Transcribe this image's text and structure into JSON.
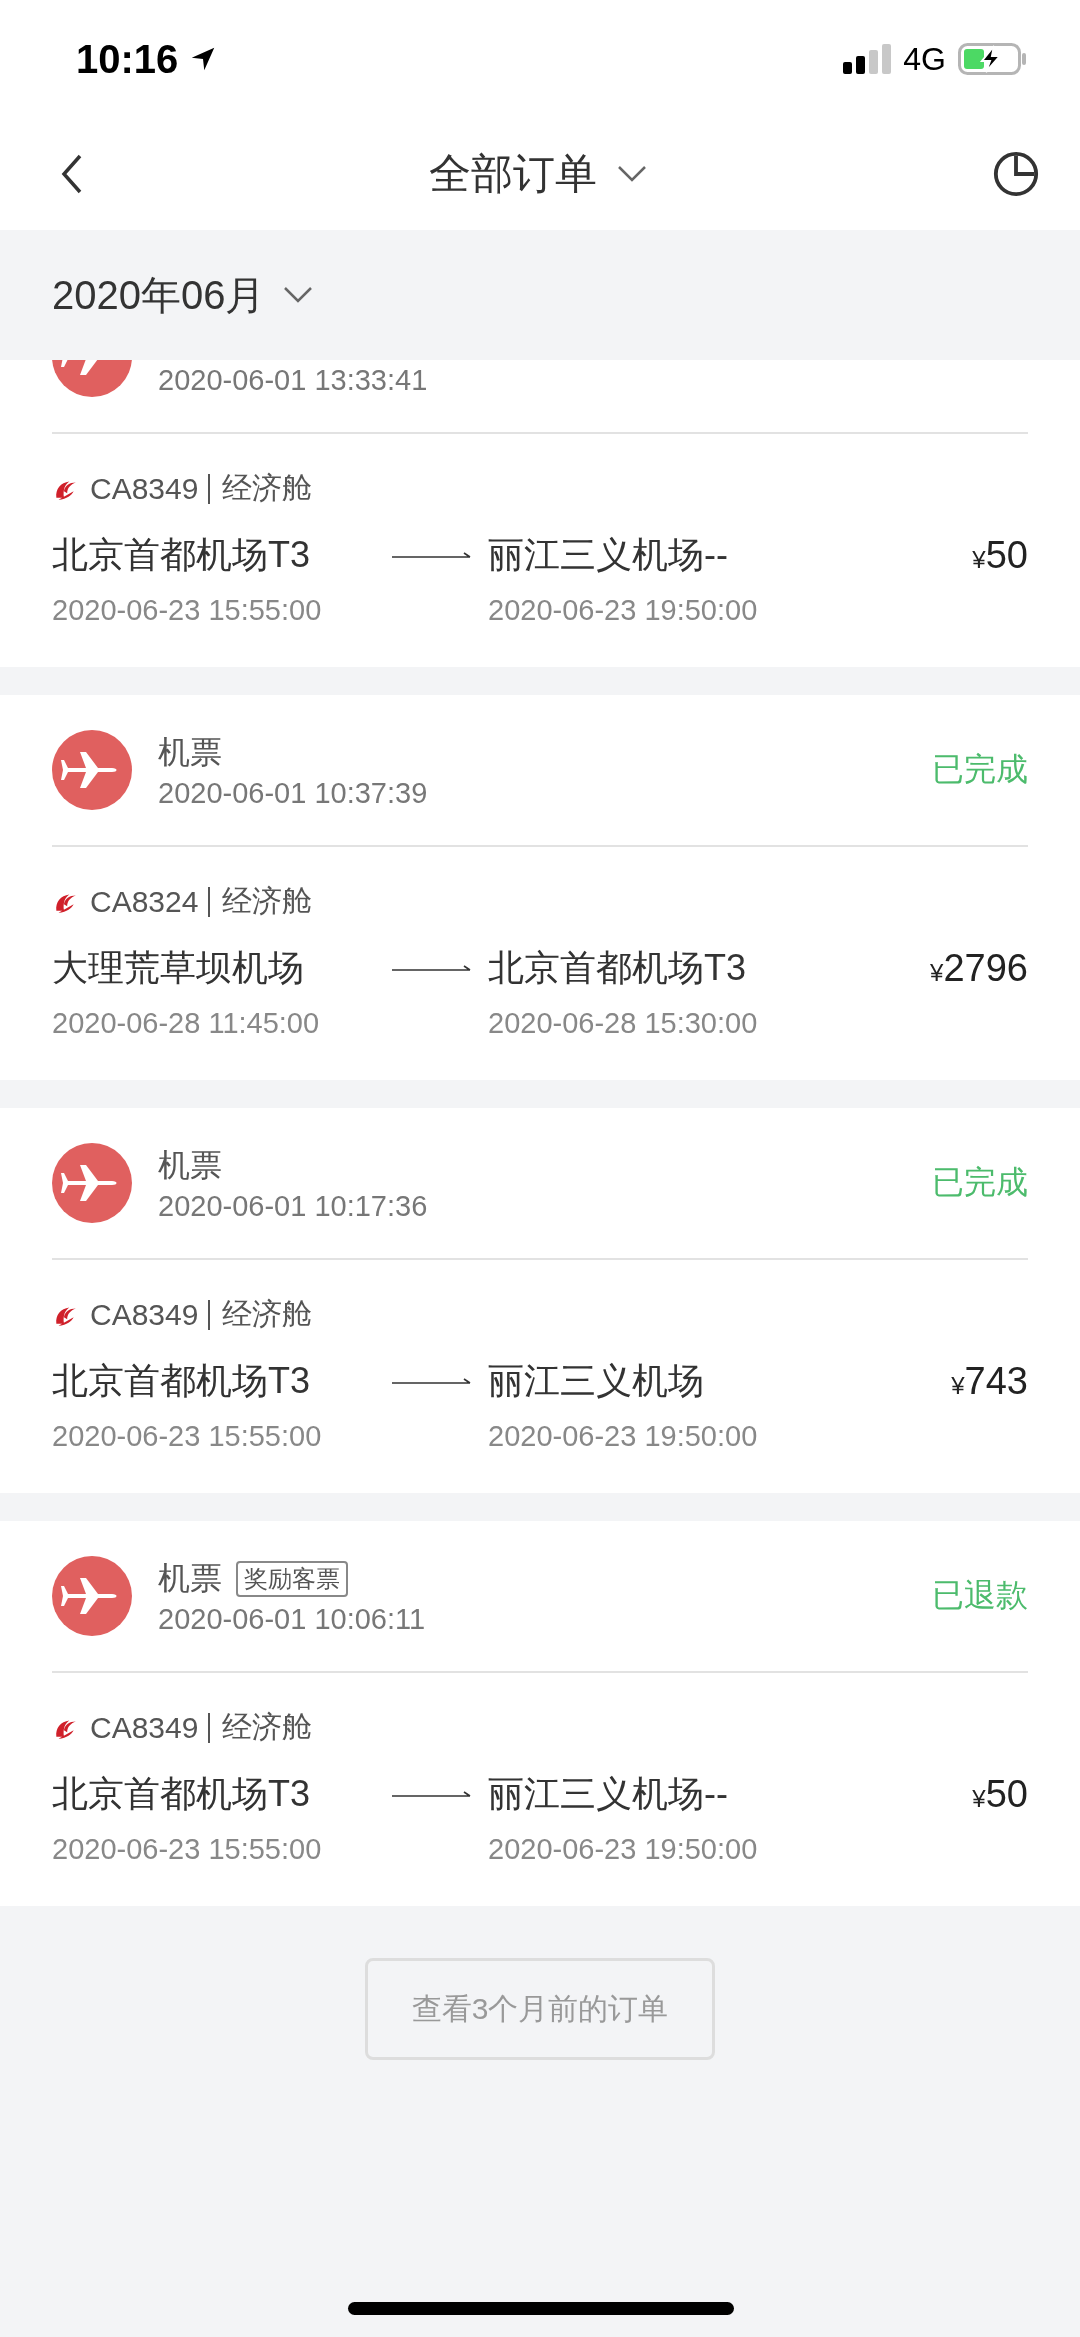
{
  "status_bar": {
    "time": "10:16",
    "network": "4G"
  },
  "nav": {
    "title": "全部订单"
  },
  "month": "2020年06月",
  "orders": [
    {
      "clipped": true,
      "created": "2020-06-01 13:33:41",
      "flight": "CA8349",
      "cabin": "经济舱",
      "from": "北京首都机场T3",
      "depart": "2020-06-23 15:55:00",
      "to": "丽江三义机场--",
      "arrive": "2020-06-23 19:50:00",
      "currency": "¥",
      "price": "50"
    },
    {
      "clipped": false,
      "title": "机票",
      "created": "2020-06-01 10:37:39",
      "status": "已完成",
      "flight": "CA8324",
      "cabin": "经济舱",
      "from": "大理荒草坝机场",
      "depart": "2020-06-28 11:45:00",
      "to": "北京首都机场T3",
      "arrive": "2020-06-28 15:30:00",
      "currency": "¥",
      "price": "2796"
    },
    {
      "clipped": false,
      "title": "机票",
      "created": "2020-06-01 10:17:36",
      "status": "已完成",
      "flight": "CA8349",
      "cabin": "经济舱",
      "from": "北京首都机场T3",
      "depart": "2020-06-23 15:55:00",
      "to": "丽江三义机场",
      "arrive": "2020-06-23 19:50:00",
      "currency": "¥",
      "price": "743"
    },
    {
      "clipped": false,
      "title": "机票",
      "tag": "奖励客票",
      "created": "2020-06-01 10:06:11",
      "status": "已退款",
      "flight": "CA8349",
      "cabin": "经济舱",
      "from": "北京首都机场T3",
      "depart": "2020-06-23 15:55:00",
      "to": "丽江三义机场--",
      "arrive": "2020-06-23 19:50:00",
      "currency": "¥",
      "price": "50"
    }
  ],
  "more_button": "查看3个月前的订单"
}
